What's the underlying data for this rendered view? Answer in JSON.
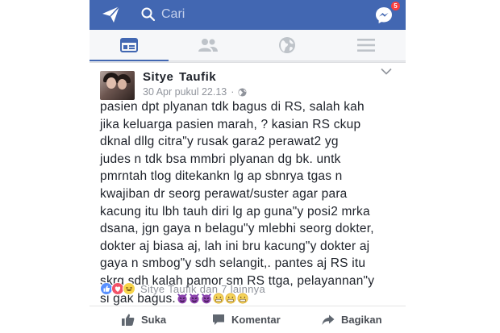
{
  "search": {
    "placeholder": "Cari"
  },
  "notifications": {
    "messenger_count": "5"
  },
  "nav": {
    "tabs": [
      "news-feed",
      "friends",
      "globe",
      "menu"
    ]
  },
  "post": {
    "author": "Sitye  Taufik",
    "timestamp": "30 Apr pukul 22.13",
    "separator": "·",
    "lines": [
      "pasien dpt plyanan tdk bagus di RS, salah kah",
      "jika keluarga pasien marah, ?  kasian RS  ckup",
      "dknal dllg citra\"y rusak gara2 perawat2 yg",
      "judes n tdk bsa mmbri plyanan dg bk. untk",
      "pmrntah tlog ditekankn lg ap sbnrya tgas n",
      "kwajiban dr seorg perawat/suster agar para",
      "kacung itu lbh tauh diri lg ap guna\"y posi2 mrka",
      "dsana, jgn gaya n belagu\"y mlebhi seorg dokter,",
      "dokter aj biasa aj, lah ini bru kacung\"y dokter aj",
      "gaya n smbog\"y sdh selangit,. pantes aj RS itu",
      "skrg sdh kalah pamor sm RS ttga, pelayannan\"y",
      "si gak bagus."
    ],
    "emojis": [
      "devil-emoji",
      "devil-emoji",
      "devil-emoji",
      "grimace-emoji",
      "grimace-emoji",
      "grimace-emoji"
    ],
    "reactions_text": "Sitye  Taufik dan 7 lainnya"
  },
  "actions": {
    "like": "Suka",
    "comment": "Komentar",
    "share": "Bagikan"
  },
  "colors": {
    "brand": "#4267b2",
    "text": "#1d2129",
    "muted": "#90949c",
    "badge": "#fa3e3e"
  }
}
